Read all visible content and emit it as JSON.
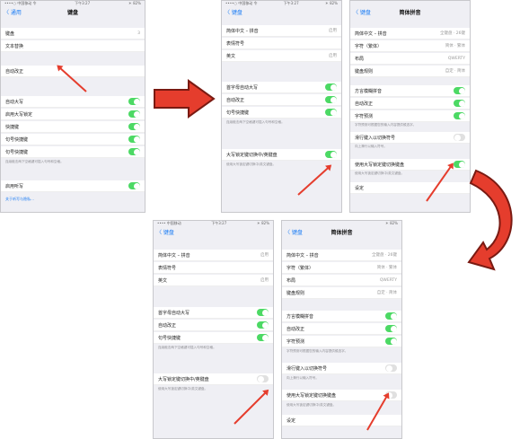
{
  "colors": {
    "toggle_on": "#4cd964",
    "accent": "#1a7cf5",
    "arrow": "#e53d2d"
  },
  "p1": {
    "status_left": "••••○ 中国移动 令",
    "status_mid": "下午3:27",
    "status_right": "＊ 82%",
    "back": "〈 通用",
    "title": "键盘",
    "rows": [
      "键盘",
      "文本替换",
      "自动改正",
      "自动大写",
      "启用大写锁定",
      "快捷键",
      "句号快捷键",
      "启用听写"
    ],
    "values": [
      "3",
      "",
      ""
    ],
    "note1": "连续敲击两下空格键可插入句号和空格。",
    "link": "关于听写与隐私…"
  },
  "p2": {
    "status_left": "••••○ 中国移动 令",
    "status_mid": "下午3:27",
    "status_right": "＊ 82%",
    "back": "〈 键盘",
    "rows": [
      "简体中文 – 拼音",
      "表情符号",
      "英文",
      "首字母自动大写",
      "自动改正",
      "句号快捷键",
      "大写锁定键切换中/英键盘"
    ],
    "values": [
      "启用",
      "启用"
    ],
    "note1": "连续敲击两下空格键可插入句号和空格。",
    "note2": "使用大写锁定键切换中/英文键盘。"
  },
  "p3": {
    "back": "〈 键盘",
    "title": "简体拼音",
    "rows": [
      "简体中文 – 拼音",
      "字符（繁体）",
      "布局",
      "键盘规则",
      "方言模糊拼音",
      "自动改正",
      "字符预测",
      "滑行键入以切换符号",
      "使用大写锁定键切换键盘",
      "设定"
    ],
    "values": [
      "全键盘 · 26键",
      "简体 · 繁体",
      "QWERTY",
      "自定 · 简体"
    ],
    "note1": "字符预测可根据您的输入内容提供候选字。",
    "note2": "向上滑行以输入符号。",
    "note3": "使用大写锁定键切换中/英文键盘。"
  },
  "p4": {
    "status_left": "•••• 中国移动",
    "status_mid": "下午3:27",
    "status_right": "＊ 82%",
    "back": "〈 键盘",
    "rows": [
      "简体中文 – 拼音",
      "表情符号",
      "英文",
      "首字母自动大写",
      "自动改正",
      "句号快捷键",
      "大写锁定键切换中/英键盘"
    ],
    "values": [
      "启用",
      "启用"
    ],
    "note1": "连续敲击两下空格键可插入句号和空格。",
    "note2": "使用大写锁定键切换中/英文键盘。"
  },
  "p5": {
    "status_right": "＊ 82%",
    "back": "〈 键盘",
    "title": "简体拼音",
    "rows": [
      "简体中文 – 拼音",
      "字符（繁体）",
      "布局",
      "键盘规则",
      "方言模糊拼音",
      "自动改正",
      "字符预测",
      "滑行键入以切换符号",
      "使用大写锁定键切换键盘",
      "设定"
    ],
    "values": [
      "全键盘 · 26键",
      "简体 · 繁体",
      "QWERTY",
      "自定 · 简体"
    ],
    "note1": "字符预测可根据您的输入内容提供候选字。",
    "note2": "向上滑行以输入符号。",
    "note3": "使用大写锁定键切换中/英文键盘。"
  }
}
